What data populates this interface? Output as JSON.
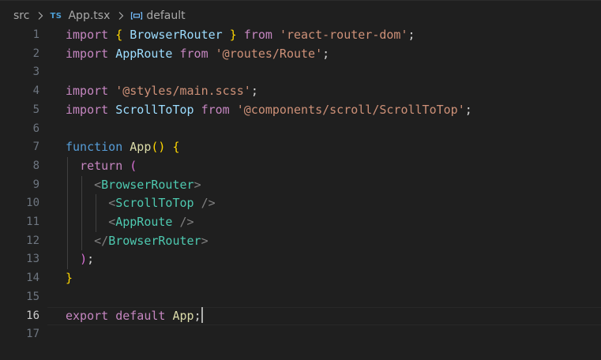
{
  "breadcrumb": {
    "folder": "src",
    "file_badge": "TS",
    "file": "App.tsx",
    "symbol": "default",
    "symbol_icon": "variable-symbol-icon",
    "separator_icon": "chevron-right-icon"
  },
  "editor": {
    "current_line": 16,
    "lines": [
      {
        "num": "1",
        "tokens": [
          [
            "import",
            "k-import"
          ],
          [
            " ",
            "plain"
          ],
          [
            "{",
            "brace"
          ],
          [
            " BrowserRouter ",
            "ident"
          ],
          [
            "}",
            "brace"
          ],
          [
            " ",
            "plain"
          ],
          [
            "from",
            "k-import"
          ],
          [
            " ",
            "plain"
          ],
          [
            "'react-router-dom'",
            "str"
          ],
          [
            ";",
            "plain"
          ]
        ]
      },
      {
        "num": "2",
        "tokens": [
          [
            "import",
            "k-import"
          ],
          [
            " ",
            "plain"
          ],
          [
            "AppRoute",
            "ident"
          ],
          [
            " ",
            "plain"
          ],
          [
            "from",
            "k-import"
          ],
          [
            " ",
            "plain"
          ],
          [
            "'@routes/Route'",
            "str"
          ],
          [
            ";",
            "plain"
          ]
        ]
      },
      {
        "num": "3",
        "tokens": []
      },
      {
        "num": "4",
        "tokens": [
          [
            "import",
            "k-import"
          ],
          [
            " ",
            "plain"
          ],
          [
            "'@styles/main.scss'",
            "str"
          ],
          [
            ";",
            "plain"
          ]
        ]
      },
      {
        "num": "5",
        "tokens": [
          [
            "import",
            "k-import"
          ],
          [
            " ",
            "plain"
          ],
          [
            "ScrollToTop",
            "ident"
          ],
          [
            " ",
            "plain"
          ],
          [
            "from",
            "k-import"
          ],
          [
            " ",
            "plain"
          ],
          [
            "'@components/scroll/ScrollToTop'",
            "str"
          ],
          [
            ";",
            "plain"
          ]
        ]
      },
      {
        "num": "6",
        "tokens": []
      },
      {
        "num": "7",
        "tokens": [
          [
            "function",
            "k-func"
          ],
          [
            " ",
            "plain"
          ],
          [
            "App",
            "fname"
          ],
          [
            "()",
            "brace"
          ],
          [
            " ",
            "plain"
          ],
          [
            "{",
            "brace"
          ]
        ]
      },
      {
        "num": "8",
        "tokens": [
          [
            "  ",
            "plain"
          ],
          [
            "return",
            "k-import"
          ],
          [
            " ",
            "plain"
          ],
          [
            "(",
            "paren-p"
          ]
        ]
      },
      {
        "num": "9",
        "tokens": [
          [
            "    ",
            "plain"
          ],
          [
            "<",
            "tagbr"
          ],
          [
            "BrowserRouter",
            "tag"
          ],
          [
            ">",
            "tagbr"
          ]
        ]
      },
      {
        "num": "10",
        "tokens": [
          [
            "      ",
            "plain"
          ],
          [
            "<",
            "tagbr"
          ],
          [
            "ScrollToTop",
            "tag"
          ],
          [
            " ",
            "plain"
          ],
          [
            "/>",
            "tagbr"
          ]
        ]
      },
      {
        "num": "11",
        "tokens": [
          [
            "      ",
            "plain"
          ],
          [
            "<",
            "tagbr"
          ],
          [
            "AppRoute",
            "tag"
          ],
          [
            " ",
            "plain"
          ],
          [
            "/>",
            "tagbr"
          ]
        ]
      },
      {
        "num": "12",
        "tokens": [
          [
            "    ",
            "plain"
          ],
          [
            "</",
            "tagbr"
          ],
          [
            "BrowserRouter",
            "tag"
          ],
          [
            ">",
            "tagbr"
          ]
        ]
      },
      {
        "num": "13",
        "tokens": [
          [
            "  ",
            "plain"
          ],
          [
            ")",
            "paren-p"
          ],
          [
            ";",
            "plain"
          ]
        ]
      },
      {
        "num": "14",
        "tokens": [
          [
            "}",
            "brace"
          ]
        ]
      },
      {
        "num": "15",
        "tokens": []
      },
      {
        "num": "16",
        "tokens": [
          [
            "export",
            "k-import"
          ],
          [
            " ",
            "plain"
          ],
          [
            "default",
            "k-import"
          ],
          [
            " ",
            "plain"
          ],
          [
            "App",
            "fname"
          ],
          [
            ";",
            "plain"
          ]
        ]
      },
      {
        "num": "17",
        "tokens": []
      }
    ]
  }
}
